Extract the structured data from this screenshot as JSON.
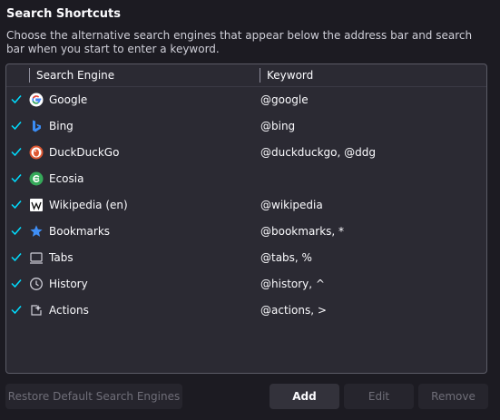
{
  "section": {
    "title": "Search Shortcuts",
    "description": "Choose the alternative search engines that appear below the address bar and search bar when you start to enter a keyword."
  },
  "table": {
    "headers": {
      "engine": "Search Engine",
      "keyword": "Keyword"
    },
    "rows": [
      {
        "checked": true,
        "icon": "google-icon",
        "name": "Google",
        "keyword": "@google"
      },
      {
        "checked": true,
        "icon": "bing-icon",
        "name": "Bing",
        "keyword": "@bing"
      },
      {
        "checked": true,
        "icon": "duckduckgo-icon",
        "name": "DuckDuckGo",
        "keyword": "@duckduckgo, @ddg"
      },
      {
        "checked": true,
        "icon": "ecosia-icon",
        "name": "Ecosia",
        "keyword": ""
      },
      {
        "checked": true,
        "icon": "wikipedia-icon",
        "name": "Wikipedia (en)",
        "keyword": "@wikipedia"
      },
      {
        "checked": true,
        "icon": "star-icon",
        "name": "Bookmarks",
        "keyword": "@bookmarks, *"
      },
      {
        "checked": true,
        "icon": "tabs-icon",
        "name": "Tabs",
        "keyword": "@tabs, %"
      },
      {
        "checked": true,
        "icon": "clock-icon",
        "name": "History",
        "keyword": "@history, ^"
      },
      {
        "checked": true,
        "icon": "actions-icon",
        "name": "Actions",
        "keyword": "@actions, >"
      }
    ]
  },
  "buttons": {
    "restore": "Restore Default Search Engines",
    "add": "Add",
    "edit": "Edit",
    "remove": "Remove"
  },
  "colors": {
    "check": "#00ddff",
    "accent": "#0df"
  }
}
